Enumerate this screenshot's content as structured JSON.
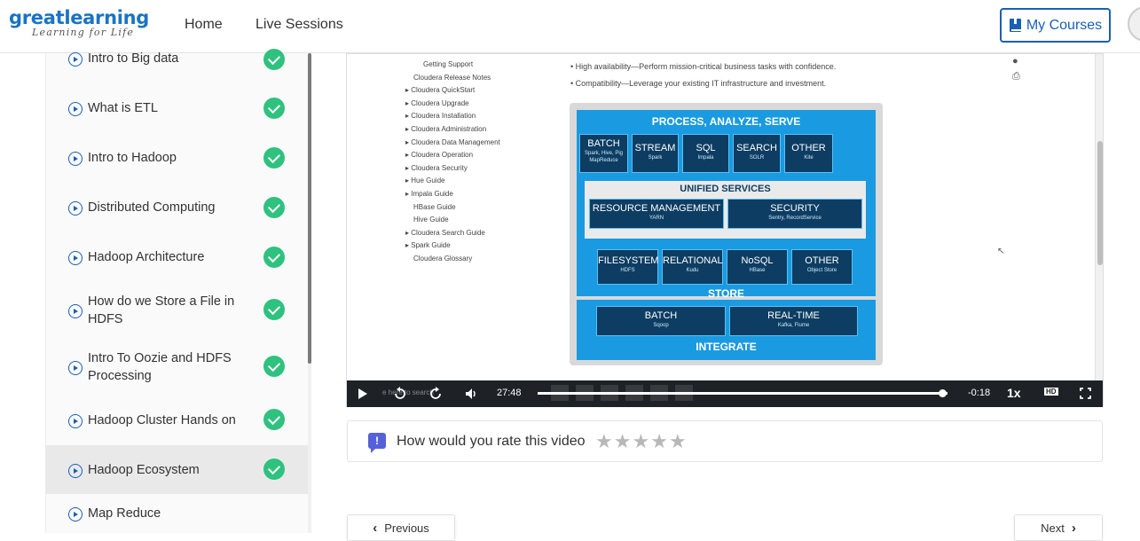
{
  "header": {
    "logo_main": "greatlearning",
    "logo_tagline": "Learning for Life",
    "nav": [
      {
        "label": "Home"
      },
      {
        "label": "Live Sessions"
      }
    ],
    "my_courses_label": "My Courses"
  },
  "sidebar": {
    "lessons": [
      {
        "label": "Intro to Big data",
        "completed": true,
        "active": false
      },
      {
        "label": "What is ETL",
        "completed": true,
        "active": false
      },
      {
        "label": "Intro to Hadoop",
        "completed": true,
        "active": false
      },
      {
        "label": "Distributed Computing",
        "completed": true,
        "active": false
      },
      {
        "label": "Hadoop Architecture",
        "completed": true,
        "active": false
      },
      {
        "label": "How do we Store a File in HDFS",
        "completed": true,
        "active": false
      },
      {
        "label": "Intro To Oozie and HDFS Processing",
        "completed": true,
        "active": false
      },
      {
        "label": "Hadoop Cluster Hands on",
        "completed": true,
        "active": false
      },
      {
        "label": "Hadoop Ecosystem",
        "completed": true,
        "active": true
      },
      {
        "label": "Map Reduce",
        "completed": false,
        "active": false
      }
    ]
  },
  "video_content": {
    "doc_nav": [
      "Getting Support",
      "Cloudera Release Notes",
      "▸ Cloudera QuickStart",
      "▸ Cloudera Upgrade",
      "▸ Cloudera Installation",
      "▸ Cloudera Administration",
      "▸ Cloudera Data Management",
      "▸ Cloudera Operation",
      "▸ Cloudera Security",
      "▸ Hue Guide",
      "▸ Impala Guide",
      "HBase Guide",
      "Hive Guide",
      "▸ Cloudera Search Guide",
      "▸ Spark Guide",
      "Cloudera Glossary"
    ],
    "bullets": [
      "•  High availability—Perform mission-critical business tasks with confidence.",
      "•  Compatibility—Leverage your existing IT infrastructure and investment."
    ],
    "diagram": {
      "process_title": "PROCESS, ANALYZE, SERVE",
      "process_boxes": [
        {
          "title": "BATCH",
          "sub": "Spark, Hive, Pig MapReduce"
        },
        {
          "title": "STREAM",
          "sub": "Spark"
        },
        {
          "title": "SQL",
          "sub": "Impala"
        },
        {
          "title": "SEARCH",
          "sub": "SOLR"
        },
        {
          "title": "OTHER",
          "sub": "Kite"
        }
      ],
      "unified_title": "UNIFIED SERVICES",
      "unified_boxes": [
        {
          "title": "RESOURCE MANAGEMENT",
          "sub": "YARN"
        },
        {
          "title": "SECURITY",
          "sub": "Sentry, RecordService"
        }
      ],
      "store_boxes": [
        {
          "title": "FILESYSTEM",
          "sub": "HDFS"
        },
        {
          "title": "RELATIONAL",
          "sub": "Kudu"
        },
        {
          "title": "NoSQL",
          "sub": "HBase"
        },
        {
          "title": "OTHER",
          "sub": "Object Store"
        }
      ],
      "store_title": "STORE",
      "integrate_boxes": [
        {
          "title": "BATCH",
          "sub": "Sqoop"
        },
        {
          "title": "REAL-TIME",
          "sub": "Kafka, Flume"
        }
      ],
      "integrate_title": "INTEGRATE"
    }
  },
  "player": {
    "current_time": "27:48",
    "remaining_time": "-0:18",
    "speed": "1x",
    "quality_badge": "HD",
    "progress": 0.986,
    "search_ghost": "e here to search"
  },
  "rating": {
    "prompt": "How would you rate this video",
    "stars": 5,
    "icon": "!"
  },
  "pager": {
    "previous_label": "Previous",
    "next_label": "Next"
  }
}
